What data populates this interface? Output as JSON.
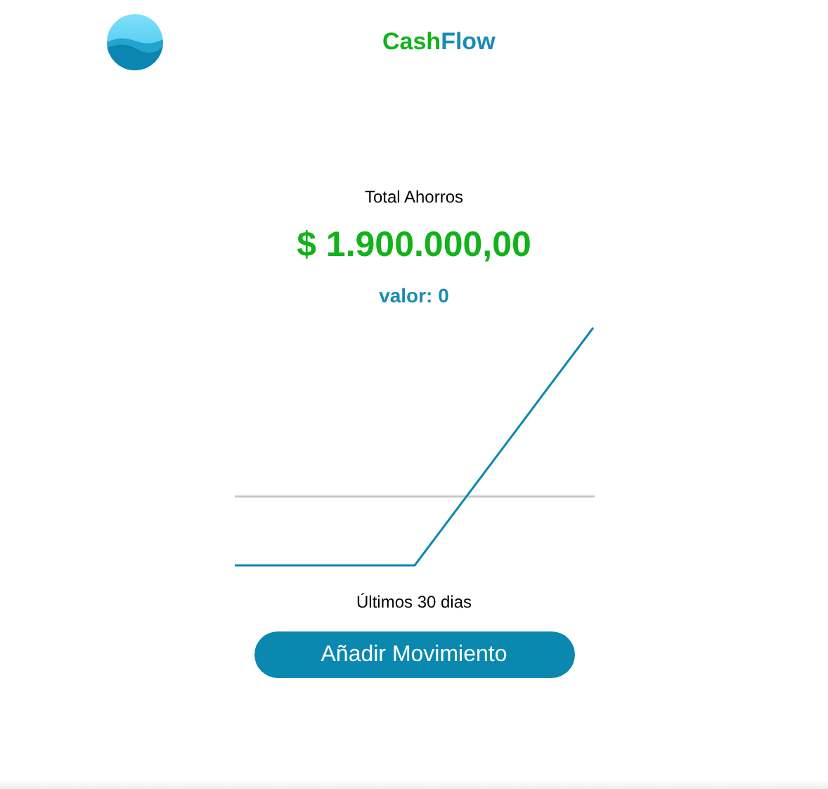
{
  "header": {
    "app_title": {
      "parts": [
        "Cash",
        "Flow"
      ]
    }
  },
  "summary": {
    "label": "Total Ahorros",
    "amount": "$ 1.900.000,00",
    "value_text": "valor: 0"
  },
  "chart": {
    "caption": "Últimos 30 dias"
  },
  "buttons": [
    {
      "label": "Añadir Movimiento"
    }
  ]
}
